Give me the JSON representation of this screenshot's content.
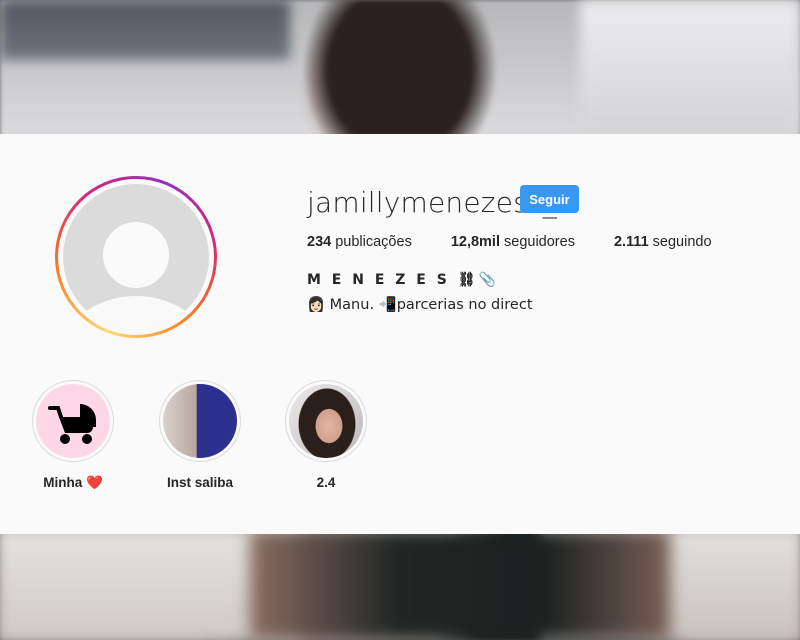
{
  "profile": {
    "username": "jamillymenezess_",
    "follow_label": "Seguir",
    "stats": {
      "posts_value": "234",
      "posts_label": "publicações",
      "followers_value": "12,8mil",
      "followers_label": "seguidores",
      "following_value": "2.111",
      "following_label": "seguindo"
    },
    "full_name": "M E N E Z E S ⛓📎",
    "bio": "👩🏻 Manu. 📲parcerias no direct"
  },
  "highlights": [
    {
      "label": "Minha ❤️",
      "icon": "baby-stroller-icon"
    },
    {
      "label": "Inst saliba",
      "icon": "cover-image"
    },
    {
      "label": "2.4",
      "icon": "cover-image"
    }
  ],
  "colors": {
    "follow_button": "#3897f0",
    "card_background": "#fafafa",
    "text": "#262626",
    "highlight1_background": "#ffd7e6"
  }
}
